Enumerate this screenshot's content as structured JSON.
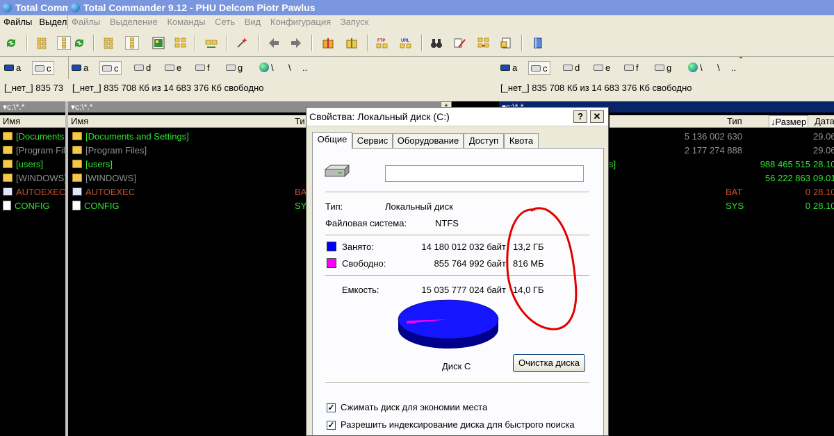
{
  "window": {
    "title_behind": "Total Comm",
    "title": "Total Commander 9.12 - PHU Delcom Piotr Pawlus"
  },
  "menu_behind": [
    "Файлы",
    "Выдел"
  ],
  "menu": [
    "Файлы",
    "Выделение",
    "Команды",
    "Сеть",
    "Вид",
    "Конфигурация",
    "Запуск"
  ],
  "drives": {
    "left": [
      "a",
      "c",
      "d",
      "e",
      "f",
      "g",
      "\\",
      ".."
    ],
    "right": [
      "a",
      "c",
      "d",
      "e",
      "f",
      "g",
      "\\",
      ".."
    ],
    "behind": [
      "a",
      "c"
    ],
    "selected": "c"
  },
  "info": {
    "behind": "[_нет_]  835 73",
    "left": "[_нет_]  835 708 Кб из 14 683 376 Кб свободно",
    "right": "[_нет_]  835 708 Кб из 14 683 376 Кб свободно"
  },
  "paths": {
    "behind": "c:\\*.*",
    "left": "c:\\*.*",
    "right": "c:\\*.*",
    "right_star": "*"
  },
  "columns": {
    "name": "Имя",
    "type_short": "Ти",
    "type": "Тип",
    "size": "↓Размер",
    "date": "Дата"
  },
  "files_left": [
    {
      "name": "[Documents and Settings]",
      "ext": "",
      "kind": "folder",
      "color": "green"
    },
    {
      "name": "[Program Files]",
      "ext": "",
      "kind": "folder",
      "color": "gray"
    },
    {
      "name": "[users]",
      "ext": "",
      "kind": "folder",
      "color": "green"
    },
    {
      "name": "[WINDOWS]",
      "ext": "",
      "kind": "folder",
      "color": "gray"
    },
    {
      "name": "AUTOEXEC",
      "ext": "BA",
      "kind": "bat",
      "color": "red"
    },
    {
      "name": "CONFIG",
      "ext": "SY",
      "kind": "file",
      "color": "green"
    }
  ],
  "files_behind": [
    "[Documents",
    "[Program Files",
    "[users]",
    "[WINDOWS]",
    "AUTOEXEC",
    "CONFIG"
  ],
  "files_right": [
    {
      "fragment": "",
      "ext": "",
      "size": "5 136 002 630",
      "date": "29.06",
      "color": "gray"
    },
    {
      "fragment": "",
      "ext": "",
      "size": "2 177 274 888",
      "date": "29.06",
      "color": "gray"
    },
    {
      "fragment": "s]",
      "ext": "",
      "size": "988 465 515",
      "date": "28.10",
      "color": "green"
    },
    {
      "fragment": "",
      "ext": "",
      "size": "56 222 863",
      "date": "09.01",
      "color": "green"
    },
    {
      "fragment": "",
      "ext": "BAT",
      "size": "0",
      "date": "28.10",
      "color": "red"
    },
    {
      "fragment": "",
      "ext": "SYS",
      "size": "0",
      "date": "28.10",
      "color": "green"
    }
  ],
  "dialog": {
    "title": "Свойства: Локальный диск (C:)",
    "help": "?",
    "close": "✕",
    "tabs": [
      "Общие",
      "Сервис",
      "Оборудование",
      "Доступ",
      "Квота"
    ],
    "label_value": "",
    "type_label": "Тип:",
    "type_value": "Локальный диск",
    "fs_label": "Файловая система:",
    "fs_value": "NTFS",
    "used_label": "Занято:",
    "used_bytes": "14 180 012 032 байт",
    "used_gb": "13,2 ГБ",
    "free_label": "Свободно:",
    "free_bytes": "855 764 992 байт",
    "free_gb": "816 МБ",
    "cap_label": "Емкость:",
    "cap_bytes": "15 035 777 024 байт",
    "cap_gb": "14,0 ГБ",
    "disk_label": "Диск C",
    "cleanup": "Очистка диска",
    "compress": "Сжимать диск для экономии места",
    "index": "Разрешить индексирование диска для быстрого поиска",
    "used_color": "#0000ff",
    "free_color": "#ff00ff",
    "free_fraction": 0.057
  }
}
